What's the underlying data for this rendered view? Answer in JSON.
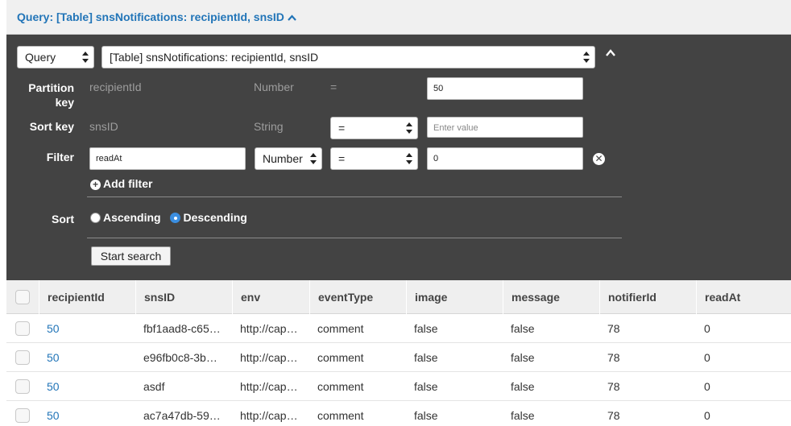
{
  "header": {
    "title": "Query: [Table] snsNotifications: recipientId, snsID"
  },
  "query_panel": {
    "mode_select": "Query",
    "table_select": "[Table] snsNotifications: recipientId, snsID",
    "partition_key": {
      "label_line1": "Partition",
      "label_line2": "key",
      "name": "recipientId",
      "type": "Number",
      "operator": "=",
      "value": "50"
    },
    "sort_key": {
      "label": "Sort key",
      "name": "snsID",
      "type": "String",
      "operator": "=",
      "placeholder": "Enter value"
    },
    "filter": {
      "label": "Filter",
      "attribute": "readAt",
      "type": "Number",
      "operator": "=",
      "value": "0"
    },
    "add_filter": "Add filter",
    "sort": {
      "label": "Sort",
      "options": [
        "Ascending",
        "Descending"
      ],
      "selected": "Descending"
    },
    "start_search": "Start search"
  },
  "table": {
    "columns": [
      "recipientId",
      "snsID",
      "env",
      "eventType",
      "image",
      "message",
      "notifierId",
      "readAt"
    ],
    "rows": [
      [
        "50",
        "fbf1aad8-c65…",
        "http://cap…",
        "comment",
        "false",
        "false",
        "78",
        "0"
      ],
      [
        "50",
        "e96fb0c8-3b…",
        "http://cap…",
        "comment",
        "false",
        "false",
        "78",
        "0"
      ],
      [
        "50",
        "asdf",
        "http://cap…",
        "comment",
        "false",
        "false",
        "78",
        "0"
      ],
      [
        "50",
        "ac7a47db-59…",
        "http://cap…",
        "comment",
        "false",
        "false",
        "78",
        "0"
      ]
    ]
  },
  "colors": {
    "accent": "#2275b8",
    "panel_bg": "#434343",
    "radio_selected": "#3b8ee0"
  }
}
